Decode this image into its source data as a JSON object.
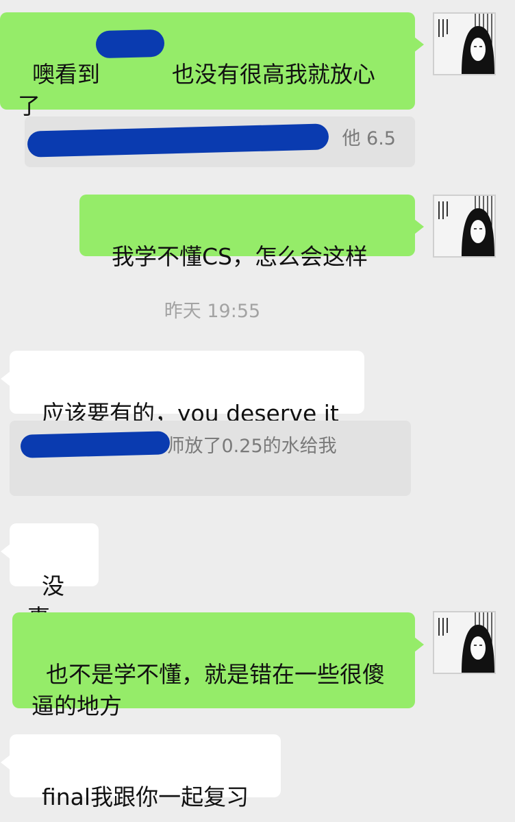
{
  "messages": [
    {
      "sender": "me",
      "text": "噢看到          也没有很高我就放心了"
    },
    {
      "sender": "quote",
      "text": "他 6.5"
    },
    {
      "sender": "me",
      "text": "我学不懂CS，怎么会这样"
    },
    {
      "sender": "timestamp",
      "text": "昨天 19:55"
    },
    {
      "sender": "other",
      "text": "应该要有的，you deserve it"
    },
    {
      "sender": "quote",
      "text": "嗯。。最后一题老师放了0.25的水给我"
    },
    {
      "sender": "other",
      "text": "没事"
    },
    {
      "sender": "me",
      "text": "也不是学不懂，就是错在一些很傻逼的地方"
    },
    {
      "sender": "other",
      "text": "final我跟你一起复习"
    }
  ],
  "colors": {
    "background": "#ededed",
    "my_bubble": "#95ec69",
    "their_bubble": "#ffffff",
    "quote_bg": "#e2e2e2",
    "redaction": "#0a3bb0"
  },
  "icons": [
    "avatar-manga-girl"
  ]
}
